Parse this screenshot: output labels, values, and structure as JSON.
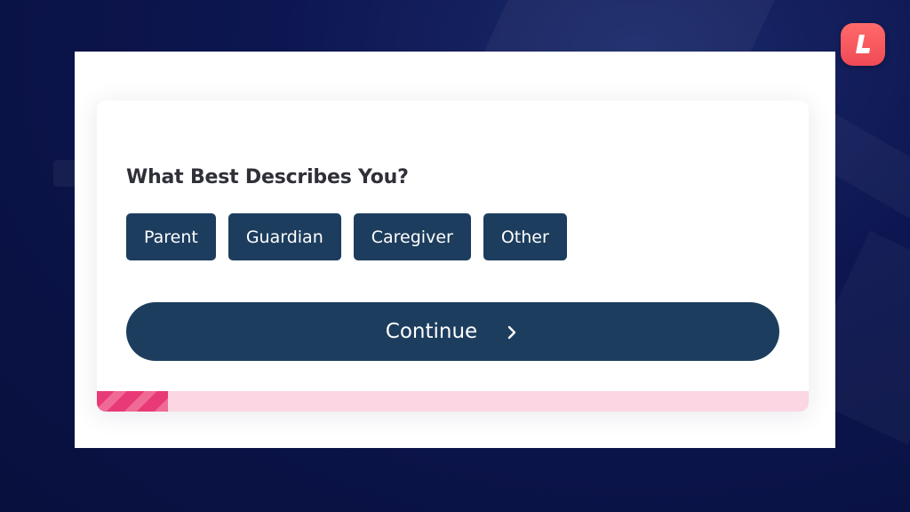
{
  "logo": {
    "letter": "L"
  },
  "form": {
    "question": "What Best Describes You?",
    "options": [
      {
        "label": "Parent"
      },
      {
        "label": "Guardian"
      },
      {
        "label": "Caregiver"
      },
      {
        "label": "Other"
      }
    ],
    "continue_label": "Continue"
  },
  "progress": {
    "fraction": 0.1
  },
  "colors": {
    "button": "#1d3d5e",
    "progress_track": "#fcd6e3",
    "progress_fill": "#e83a76",
    "logo": "#f04a55"
  }
}
